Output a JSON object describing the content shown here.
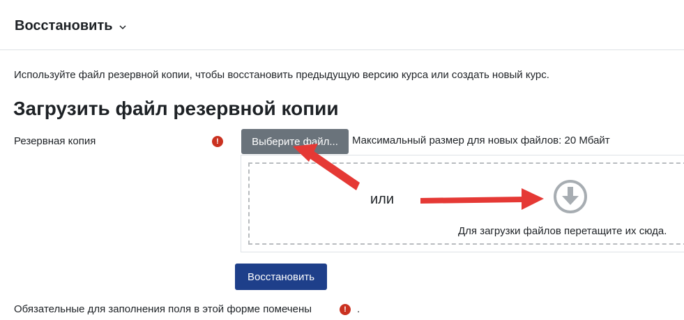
{
  "header": {
    "menu_label": "Восстановить",
    "menu_icon": "chevron-down-icon"
  },
  "intro_text": "Используйте файл резервной копии, чтобы восстановить предыдущую версию курса или создать новый курс.",
  "section_title": "Загрузить файл резервной копии",
  "form": {
    "field_label": "Резервная копия",
    "required_mark": "!",
    "choose_file_label": "Выберите файл...",
    "max_size_text": "Максимальный размер для новых файлов: 20 Мбайт",
    "dropzone": {
      "or_text": "или",
      "icon": "download-arrow-icon",
      "hint": "Для загрузки файлов перетащите их сюда."
    },
    "submit_label": "Восстановить",
    "footer_text": "Обязательные для заполнения поля в этой форме помечены",
    "footer_end": "."
  },
  "colors": {
    "choose_button": "#6a737b",
    "submit_button": "#1e3f8a",
    "required": "#ca3120",
    "annotation_arrow": "#e53935",
    "upload_icon": "#a7adb2"
  }
}
